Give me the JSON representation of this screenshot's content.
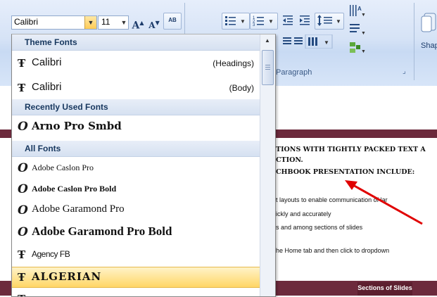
{
  "toolbar": {
    "font_name": "Calibri",
    "font_size": "11",
    "grow_font": "A",
    "shrink_font": "A",
    "clear_format": "AB",
    "paragraph_label": "Paragraph",
    "shapes_label": "Shape"
  },
  "dropdown": {
    "theme_header": "Theme Fonts",
    "recent_header": "Recently Used Fonts",
    "all_header": "All Fonts",
    "theme_items": [
      {
        "name": "Calibri",
        "tag": "(Headings)"
      },
      {
        "name": "Calibri",
        "tag": "(Body)"
      }
    ],
    "recent_items": [
      {
        "name": "Arno Pro Smbd"
      }
    ],
    "all_items": [
      {
        "name": "Adobe Caslon Pro"
      },
      {
        "name": "Adobe Caslon Pro Bold"
      },
      {
        "name": "Adobe Garamond Pro"
      },
      {
        "name": "Adobe Garamond Pro Bold"
      },
      {
        "name": "Agency FB"
      },
      {
        "name": "ALGERIAN"
      }
    ]
  },
  "document": {
    "lines": [
      "TIONS WITH TIGHTLY PACKED TEXT A",
      "CTION.",
      "CHBOOK PRESENTATION INCLUDE:",
      "t layouts to enable communication of lar",
      "ickly and accurately",
      "s and among sections of slides",
      "he Home tab and then click to dropdown"
    ],
    "sections_tab": "Sections of Slides"
  },
  "colors": {
    "ribbon": "#d6e3f6",
    "banner": "#6c2a3c",
    "selection": "#ffd666",
    "arrow": "#e00000"
  }
}
